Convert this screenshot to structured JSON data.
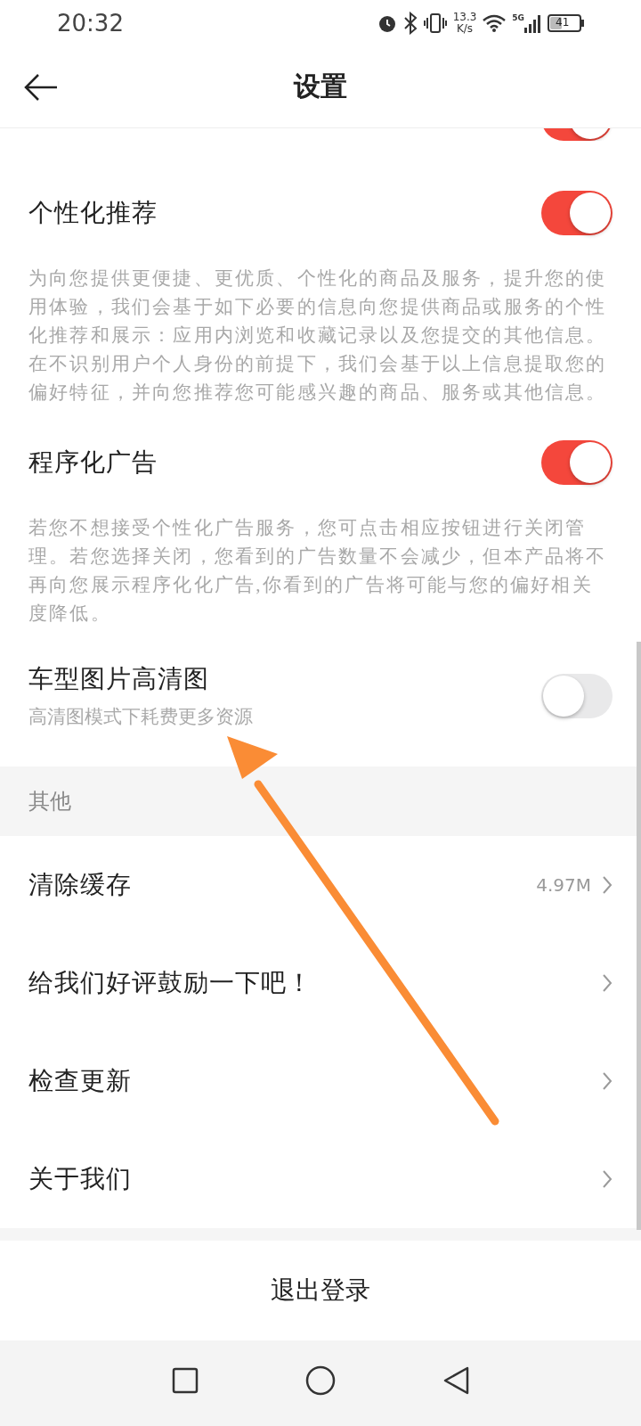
{
  "status_bar": {
    "time": "20:32",
    "speed_value": "13.3",
    "speed_unit": "K/s",
    "network": "5G",
    "battery": "41"
  },
  "header": {
    "title": "设置"
  },
  "partial_row": {
    "on": true
  },
  "settings": [
    {
      "title": "个性化推荐",
      "on": true,
      "description": "为向您提供更便捷、更优质、个性化的商品及服务，提升您的使用体验，我们会基于如下必要的信息向您提供商品或服务的个性化推荐和展示：应用内浏览和收藏记录以及您提交的其他信息。在不识别用户个人身份的前提下，我们会基于以上信息提取您的偏好特征，并向您推荐您可能感兴趣的商品、服务或其他信息。"
    },
    {
      "title": "程序化广告",
      "on": true,
      "description": "若您不想接受个性化广告服务，您可点击相应按钮进行关闭管理。若您选择关闭，您看到的广告数量不会减少，但本产品将不再向您展示程序化化广告,你看到的广告将可能与您的偏好相关度降低。"
    },
    {
      "title": "车型图片高清图",
      "on": false,
      "subtitle": "高清图模式下耗费更多资源"
    }
  ],
  "section": {
    "title": "其他"
  },
  "links": [
    {
      "label": "清除缓存",
      "value": "4.97M"
    },
    {
      "label": "给我们好评鼓励一下吧！"
    },
    {
      "label": "检查更新"
    },
    {
      "label": "关于我们"
    }
  ],
  "logout": {
    "label": "退出登录"
  }
}
